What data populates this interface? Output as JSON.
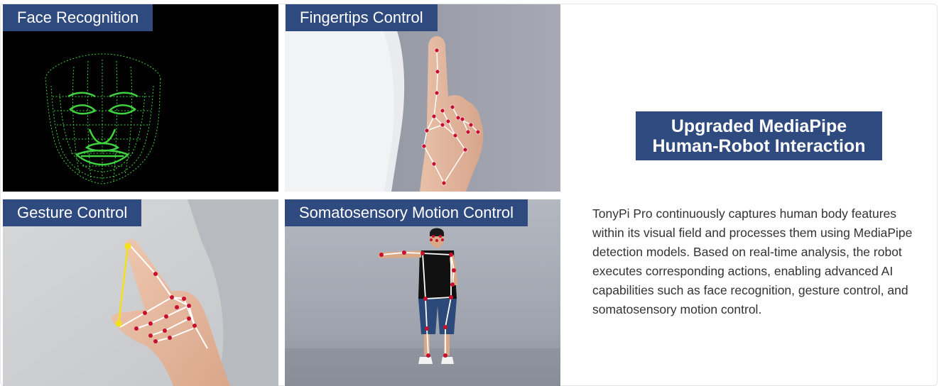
{
  "tiles": {
    "face": {
      "label": "Face Recognition"
    },
    "fingertips": {
      "label": "Fingertips Control"
    },
    "gesture": {
      "label": "Gesture Control"
    },
    "somatosensory": {
      "label": "Somatosensory Motion Control"
    }
  },
  "feature": {
    "heading_line1": "Upgraded MediaPipe",
    "heading_line2": "Human-Robot Interaction",
    "description": "TonyPi Pro continuously captures human body features within its visual field and processes them using MediaPipe detection models. Based on real-time analysis, the robot executes corresponding actions, enabling advanced AI capabilities such as face recognition, gesture control, and somatosensory motion control."
  },
  "colors": {
    "label_bg": "#2f4a7e",
    "mesh_green": "#3fd13f",
    "joint_red": "#c8102e",
    "skeleton_white": "#ffffff",
    "pinch_yellow": "#f2e01a"
  }
}
